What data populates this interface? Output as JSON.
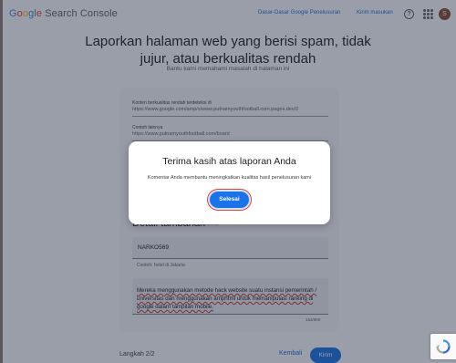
{
  "header": {
    "logo_parts": [
      "G",
      "o",
      "o",
      "g",
      "l",
      "e"
    ],
    "logo_rest": "Search Console",
    "links": [
      "Dasar-Dasar Google Penelusuran",
      "Kirim masukan"
    ],
    "help_icon": "help-icon",
    "apps_icon": "apps-grid-icon",
    "avatar_initial": "S"
  },
  "page": {
    "title": "Laporkan halaman web yang berisi spam, tidak jujur, atau berkualitas rendah",
    "subtitle": "Bantu kami memahami masalah di halaman ini"
  },
  "form": {
    "fields": [
      {
        "label": "Konten berkualitas rendah terdeteksi di",
        "value": "https://www.google.com/amp/s/www.putnamyouthfootball.com.pages.dev/2"
      },
      {
        "label": "Contoh lainnya",
        "value": "https://www.putnamyouthfootball.com/board"
      }
    ],
    "section_title": "Detail tambahan",
    "section_tag": "Opsional",
    "text_input_value": "NARKO569",
    "helper_text": "Contoh: hotel di Jakarta",
    "textarea_value": "Mereka menggunakan metode hack website suatu instansi pemerintah / universitas dan menggunakan amphtml untuk memanipulasi ranking di google dalam tampilan mobile.",
    "counter": "162/800"
  },
  "footer": {
    "step": "Langkah 2/2",
    "back": "Kembali",
    "submit": "Kirim"
  },
  "dialog": {
    "title": "Terima kasih atas laporan Anda",
    "text": "Komentar Anda membantu meningkatkan kualitas hasil penelusuran kami",
    "done": "Selesai"
  },
  "colors": {
    "accent": "#1a73e8",
    "scrim": "#202841"
  }
}
